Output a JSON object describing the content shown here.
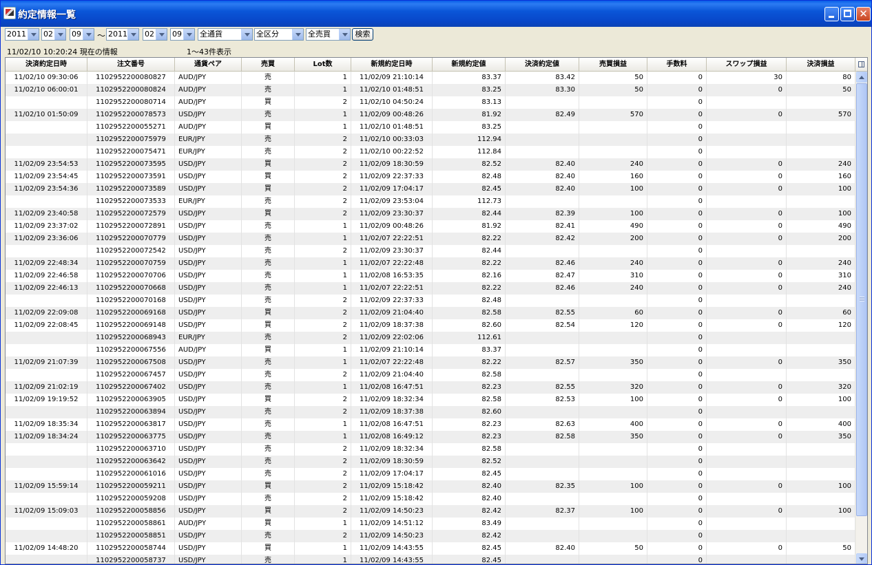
{
  "window": {
    "title": "約定情報一覧",
    "colors": {
      "titlebar": "#0A56D8",
      "row_alt": "#EEEEEE"
    }
  },
  "filters": {
    "from_year": "2011",
    "from_month": "02",
    "from_day": "09",
    "range_sep": "～",
    "to_year": "2011",
    "to_month": "02",
    "to_day": "09",
    "currency": "全通貨",
    "category": "全区分",
    "side": "全売買",
    "search_label": "検索"
  },
  "info": {
    "timestamp": "11/02/10 10:20:24  現在の情報",
    "range": "1～43件表示"
  },
  "table": {
    "headers": [
      "決済約定日時",
      "注文番号",
      "通貨ペア",
      "売買",
      "Lot数",
      "新規約定日時",
      "新規約定値",
      "決済約定値",
      "売買損益",
      "手数料",
      "スワップ損益",
      "決済損益"
    ],
    "rows": [
      [
        "11/02/10 09:30:06",
        "1102952200080827",
        "AUD/JPY",
        "売",
        "1",
        "11/02/09 21:10:14",
        "83.37",
        "83.42",
        "50",
        "0",
        "30",
        "80"
      ],
      [
        "11/02/10 06:00:01",
        "1102952200080824",
        "AUD/JPY",
        "売",
        "1",
        "11/02/10 01:48:51",
        "83.25",
        "83.30",
        "50",
        "0",
        "0",
        "50"
      ],
      [
        "",
        "1102952200080714",
        "AUD/JPY",
        "買",
        "2",
        "11/02/10 04:50:24",
        "83.13",
        "",
        "",
        "0",
        "",
        ""
      ],
      [
        "11/02/10 01:50:09",
        "1102952200078573",
        "USD/JPY",
        "売",
        "1",
        "11/02/09 00:48:26",
        "81.92",
        "82.49",
        "570",
        "0",
        "0",
        "570"
      ],
      [
        "",
        "1102952200055271",
        "AUD/JPY",
        "買",
        "1",
        "11/02/10 01:48:51",
        "83.25",
        "",
        "",
        "0",
        "",
        ""
      ],
      [
        "",
        "1102952200075979",
        "EUR/JPY",
        "売",
        "2",
        "11/02/10 00:33:03",
        "112.94",
        "",
        "",
        "0",
        "",
        ""
      ],
      [
        "",
        "1102952200075471",
        "EUR/JPY",
        "売",
        "2",
        "11/02/10 00:22:52",
        "112.84",
        "",
        "",
        "0",
        "",
        ""
      ],
      [
        "11/02/09 23:54:53",
        "1102952200073595",
        "USD/JPY",
        "買",
        "2",
        "11/02/09 18:30:59",
        "82.52",
        "82.40",
        "240",
        "0",
        "0",
        "240"
      ],
      [
        "11/02/09 23:54:45",
        "1102952200073591",
        "USD/JPY",
        "買",
        "2",
        "11/02/09 22:37:33",
        "82.48",
        "82.40",
        "160",
        "0",
        "0",
        "160"
      ],
      [
        "11/02/09 23:54:36",
        "1102952200073589",
        "USD/JPY",
        "買",
        "2",
        "11/02/09 17:04:17",
        "82.45",
        "82.40",
        "100",
        "0",
        "0",
        "100"
      ],
      [
        "",
        "1102952200073533",
        "EUR/JPY",
        "売",
        "2",
        "11/02/09 23:53:04",
        "112.73",
        "",
        "",
        "0",
        "",
        ""
      ],
      [
        "11/02/09 23:40:58",
        "1102952200072579",
        "USD/JPY",
        "買",
        "2",
        "11/02/09 23:30:37",
        "82.44",
        "82.39",
        "100",
        "0",
        "0",
        "100"
      ],
      [
        "11/02/09 23:37:02",
        "1102952200072891",
        "USD/JPY",
        "売",
        "1",
        "11/02/09 00:48:26",
        "81.92",
        "82.41",
        "490",
        "0",
        "0",
        "490"
      ],
      [
        "11/02/09 23:36:06",
        "1102952200070779",
        "USD/JPY",
        "売",
        "1",
        "11/02/07 22:22:51",
        "82.22",
        "82.42",
        "200",
        "0",
        "0",
        "200"
      ],
      [
        "",
        "1102952200072542",
        "USD/JPY",
        "売",
        "2",
        "11/02/09 23:30:37",
        "82.44",
        "",
        "",
        "0",
        "",
        ""
      ],
      [
        "11/02/09 22:48:34",
        "1102952200070759",
        "USD/JPY",
        "売",
        "1",
        "11/02/07 22:22:48",
        "82.22",
        "82.46",
        "240",
        "0",
        "0",
        "240"
      ],
      [
        "11/02/09 22:46:58",
        "1102952200070706",
        "USD/JPY",
        "売",
        "1",
        "11/02/08 16:53:35",
        "82.16",
        "82.47",
        "310",
        "0",
        "0",
        "310"
      ],
      [
        "11/02/09 22:46:13",
        "1102952200070668",
        "USD/JPY",
        "売",
        "1",
        "11/02/07 22:22:51",
        "82.22",
        "82.46",
        "240",
        "0",
        "0",
        "240"
      ],
      [
        "",
        "1102952200070168",
        "USD/JPY",
        "売",
        "2",
        "11/02/09 22:37:33",
        "82.48",
        "",
        "",
        "0",
        "",
        ""
      ],
      [
        "11/02/09 22:09:08",
        "1102952200069168",
        "USD/JPY",
        "買",
        "2",
        "11/02/09 21:04:40",
        "82.58",
        "82.55",
        "60",
        "0",
        "0",
        "60"
      ],
      [
        "11/02/09 22:08:45",
        "1102952200069148",
        "USD/JPY",
        "買",
        "2",
        "11/02/09 18:37:38",
        "82.60",
        "82.54",
        "120",
        "0",
        "0",
        "120"
      ],
      [
        "",
        "1102952200068943",
        "EUR/JPY",
        "売",
        "2",
        "11/02/09 22:02:06",
        "112.61",
        "",
        "",
        "0",
        "",
        ""
      ],
      [
        "",
        "1102952200067556",
        "AUD/JPY",
        "買",
        "1",
        "11/02/09 21:10:14",
        "83.37",
        "",
        "",
        "0",
        "",
        ""
      ],
      [
        "11/02/09 21:07:39",
        "1102952200067508",
        "USD/JPY",
        "売",
        "1",
        "11/02/07 22:22:48",
        "82.22",
        "82.57",
        "350",
        "0",
        "0",
        "350"
      ],
      [
        "",
        "1102952200067457",
        "USD/JPY",
        "売",
        "2",
        "11/02/09 21:04:40",
        "82.58",
        "",
        "",
        "0",
        "",
        ""
      ],
      [
        "11/02/09 21:02:19",
        "1102952200067402",
        "USD/JPY",
        "売",
        "1",
        "11/02/08 16:47:51",
        "82.23",
        "82.55",
        "320",
        "0",
        "0",
        "320"
      ],
      [
        "11/02/09 19:19:52",
        "1102952200063905",
        "USD/JPY",
        "買",
        "2",
        "11/02/09 18:32:34",
        "82.58",
        "82.53",
        "100",
        "0",
        "0",
        "100"
      ],
      [
        "",
        "1102952200063894",
        "USD/JPY",
        "売",
        "2",
        "11/02/09 18:37:38",
        "82.60",
        "",
        "",
        "0",
        "",
        ""
      ],
      [
        "11/02/09 18:35:34",
        "1102952200063817",
        "USD/JPY",
        "売",
        "1",
        "11/02/08 16:47:51",
        "82.23",
        "82.63",
        "400",
        "0",
        "0",
        "400"
      ],
      [
        "11/02/09 18:34:24",
        "1102952200063775",
        "USD/JPY",
        "売",
        "1",
        "11/02/08 16:49:12",
        "82.23",
        "82.58",
        "350",
        "0",
        "0",
        "350"
      ],
      [
        "",
        "1102952200063710",
        "USD/JPY",
        "売",
        "2",
        "11/02/09 18:32:34",
        "82.58",
        "",
        "",
        "0",
        "",
        ""
      ],
      [
        "",
        "1102952200063642",
        "USD/JPY",
        "売",
        "2",
        "11/02/09 18:30:59",
        "82.52",
        "",
        "",
        "0",
        "",
        ""
      ],
      [
        "",
        "1102952200061016",
        "USD/JPY",
        "売",
        "2",
        "11/02/09 17:04:17",
        "82.45",
        "",
        "",
        "0",
        "",
        ""
      ],
      [
        "11/02/09 15:59:14",
        "1102952200059211",
        "USD/JPY",
        "買",
        "2",
        "11/02/09 15:18:42",
        "82.40",
        "82.35",
        "100",
        "0",
        "0",
        "100"
      ],
      [
        "",
        "1102952200059208",
        "USD/JPY",
        "売",
        "2",
        "11/02/09 15:18:42",
        "82.40",
        "",
        "",
        "0",
        "",
        ""
      ],
      [
        "11/02/09 15:09:03",
        "1102952200058856",
        "USD/JPY",
        "買",
        "2",
        "11/02/09 14:50:23",
        "82.42",
        "82.37",
        "100",
        "0",
        "0",
        "100"
      ],
      [
        "",
        "1102952200058861",
        "AUD/JPY",
        "買",
        "1",
        "11/02/09 14:51:12",
        "83.49",
        "",
        "",
        "0",
        "",
        ""
      ],
      [
        "",
        "1102952200058851",
        "USD/JPY",
        "売",
        "2",
        "11/02/09 14:50:23",
        "82.42",
        "",
        "",
        "0",
        "",
        ""
      ],
      [
        "11/02/09 14:48:20",
        "1102952200058744",
        "USD/JPY",
        "買",
        "1",
        "11/02/09 14:43:55",
        "82.45",
        "82.40",
        "50",
        "0",
        "0",
        "50"
      ],
      [
        "",
        "1102952200058737",
        "USD/JPY",
        "売",
        "1",
        "11/02/09 14:43:55",
        "82.45",
        "",
        "",
        "0",
        "",
        ""
      ]
    ]
  },
  "icons": {
    "app": "fx-app-icon",
    "minimize": "minimize-icon",
    "maximize": "maximize-icon",
    "close": "close-icon",
    "column_chooser": "column-chooser-icon"
  }
}
